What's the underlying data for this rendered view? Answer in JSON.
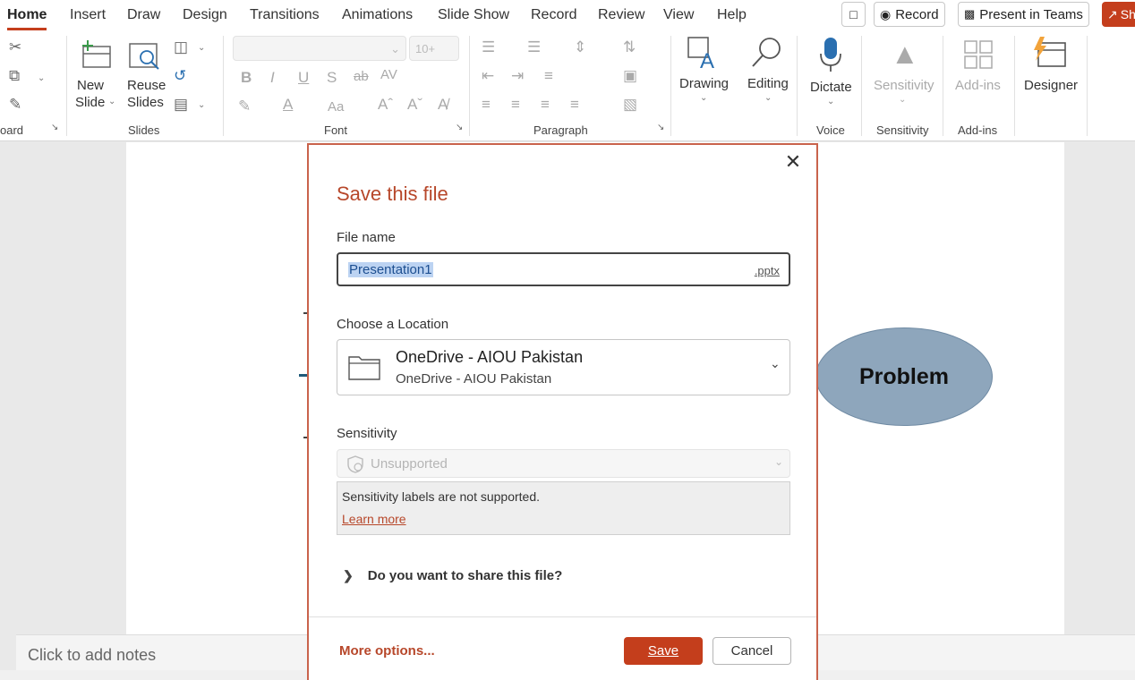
{
  "menubar": {
    "tabs": [
      {
        "label": "Home",
        "active": true
      },
      {
        "label": "Insert"
      },
      {
        "label": "Draw"
      },
      {
        "label": "Design"
      },
      {
        "label": "Transitions"
      },
      {
        "label": "Animations"
      },
      {
        "label": "Slide Show"
      },
      {
        "label": "Record"
      },
      {
        "label": "Review"
      },
      {
        "label": "View"
      },
      {
        "label": "Help"
      }
    ],
    "record_button": "Record",
    "present_teams_button": "Present in Teams",
    "share_button": "Sh"
  },
  "ribbon": {
    "clipboard_label": "oard",
    "new_slide": [
      "New",
      "Slide"
    ],
    "reuse_slides": [
      "Reuse",
      "Slides"
    ],
    "slides_label": "Slides",
    "font_size_placeholder": "10+",
    "font_label": "Font",
    "paragraph_label": "Paragraph",
    "drawing": "Drawing",
    "editing": "Editing",
    "dictate": "Dictate",
    "voice_label": "Voice",
    "sensitivity_button": "Sensitivity",
    "sensitivity_label": "Sensitivity",
    "addins_button": "Add-ins",
    "addins_label": "Add-ins",
    "designer": "Designer"
  },
  "slide": {
    "shape_text": "Problem",
    "notes_placeholder": "Click to add notes"
  },
  "dialog": {
    "title": "Save this file",
    "file_name_label": "File name",
    "file_name_value": "Presentation1",
    "file_extension": ".pptx",
    "location_label": "Choose a Location",
    "location_title": "OneDrive - AIOU Pakistan",
    "location_subtitle": "OneDrive - AIOU Pakistan",
    "sensitivity_label": "Sensitivity",
    "sensitivity_value": "Unsupported",
    "sensitivity_message": "Sensitivity labels are not supported.",
    "learn_more": "Learn more",
    "share_question": "Do you want to share this file?",
    "more_options": "More options...",
    "save_button": "Save",
    "cancel_button": "Cancel"
  },
  "colors": {
    "accent": "#c43e1c",
    "title": "#b7472a",
    "shape_fill": "#8ea6bc"
  }
}
